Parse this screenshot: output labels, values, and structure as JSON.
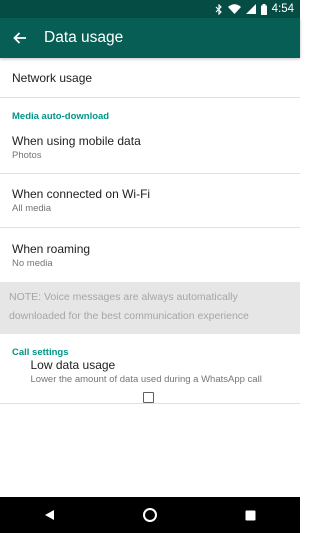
{
  "status_bar": {
    "time": "4:54"
  },
  "app_bar": {
    "title": "Data usage"
  },
  "network_usage": {
    "title": "Network usage"
  },
  "media_auto_download": {
    "category": "Media auto-download",
    "items": [
      {
        "title": "When using mobile data",
        "summary": "Photos"
      },
      {
        "title": "When connected on Wi-Fi",
        "summary": "All media"
      },
      {
        "title": "When roaming",
        "summary": "No media"
      }
    ]
  },
  "note": {
    "text": "NOTE: Voice messages are always automatically downloaded for the best communication experience"
  },
  "call_settings": {
    "category": "Call settings",
    "low_data": {
      "title": "Low data usage",
      "summary": "Lower the amount of data used during a WhatsApp call",
      "checked": false
    }
  },
  "colors": {
    "app_bar": "#075e54",
    "status_bar": "#054d44",
    "accent": "#009688",
    "note_bg": "#e6e6e6"
  },
  "icons": [
    "bluetooth-icon",
    "wifi-icon",
    "cellular-signal-icon",
    "battery-icon",
    "back-arrow-icon",
    "nav-back-icon",
    "nav-home-icon",
    "nav-recents-icon"
  ]
}
